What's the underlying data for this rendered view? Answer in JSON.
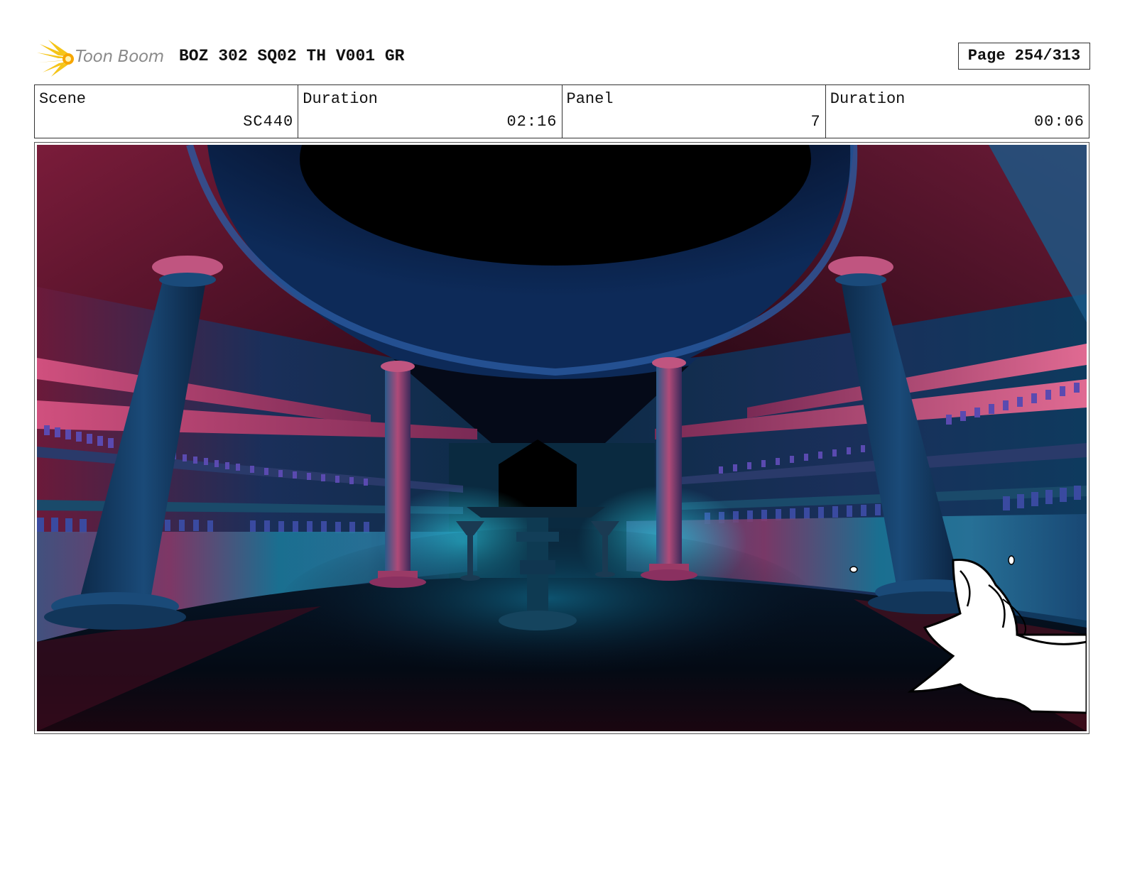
{
  "header": {
    "logo_text": "Toon Boom",
    "title": "BOZ 302 SQ02 TH V001 GR",
    "page": "Page 254/313"
  },
  "info": {
    "scene_label": "Scene",
    "scene_value": "SC440",
    "scene_duration_label": "Duration",
    "scene_duration_value": "02:16",
    "panel_label": "Panel",
    "panel_value": "7",
    "panel_duration_label": "Duration",
    "panel_duration_value": "00:06"
  },
  "colors": {
    "magenta": "#c2406e",
    "dark_red": "#4a0f20",
    "teal": "#1a8aa8",
    "navy": "#0a1f3c",
    "logo_yellow": "#f5c518"
  }
}
